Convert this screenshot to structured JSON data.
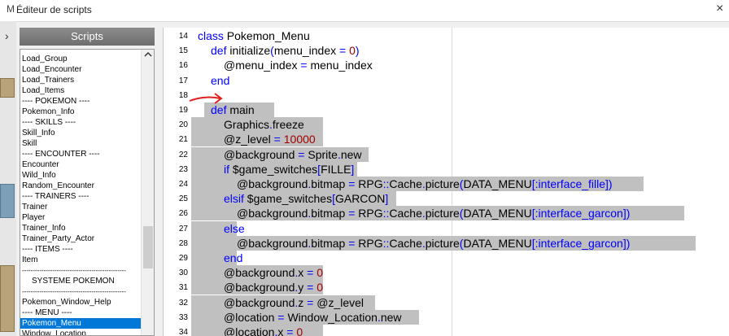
{
  "window": {
    "title": "Éditeur de scripts",
    "close": "×",
    "bg_letter": "M",
    "bg_arrow": "›"
  },
  "sidebar": {
    "header": "Scripts",
    "selected_index": 25,
    "items": [
      "Load_Group",
      "Load_Encounter",
      "Load_Trainers",
      "Load_Items",
      "---- POKEMON ----",
      "Pokemon_Info",
      "---- SKILLS ----",
      "Skill_Info",
      "Skill",
      "---- ENCOUNTER ----",
      "Encounter",
      "Wild_Info",
      "Random_Encounter",
      "---- TRAINERS ----",
      "Trainer",
      "Player",
      "Trainer_Info",
      "Trainer_Party_Actor",
      "---- ITEMS ----",
      "Item",
      "------------------------------------------------",
      "SYSTEME POKEMON",
      "------------------------------------------------",
      "Pokemon_Window_Help",
      "---- MENU ----",
      "Pokemon_Menu",
      "Window_Location"
    ]
  },
  "editor": {
    "lines": [
      {
        "n": "14",
        "sel": 0,
        "indent": 0,
        "t": [
          [
            "kw",
            "class"
          ],
          [
            "",
            "Pokemon_Menu"
          ]
        ]
      },
      {
        "n": "15",
        "sel": 0,
        "indent": 1,
        "t": [
          [
            "kw",
            "def"
          ],
          [
            "",
            "initialize"
          ],
          [
            "op",
            "("
          ],
          [
            "",
            "menu_index"
          ],
          [
            "op",
            " = "
          ],
          [
            "num",
            "0"
          ],
          [
            "op",
            ")"
          ]
        ]
      },
      {
        "n": "16",
        "sel": 0,
        "indent": 2,
        "t": [
          [
            "",
            "@menu_index"
          ],
          [
            "op",
            " = "
          ],
          [
            "",
            "menu_index"
          ]
        ]
      },
      {
        "n": "17",
        "sel": 0,
        "indent": 1,
        "t": [
          [
            "kw",
            "end"
          ]
        ]
      },
      {
        "n": "18",
        "sel": 0,
        "indent": 0,
        "t": []
      },
      {
        "n": "19",
        "sel": 86,
        "indent": 1,
        "t": [
          [
            "kw",
            "def"
          ],
          [
            "",
            "main"
          ]
        ]
      },
      {
        "n": "20",
        "sel": 162,
        "indent": 2,
        "t": [
          [
            "",
            "Graphics"
          ],
          [
            "op",
            "."
          ],
          [
            "",
            "freeze"
          ]
        ]
      },
      {
        "n": "21",
        "sel": 162,
        "indent": 2,
        "t": [
          [
            "",
            "@z_level"
          ],
          [
            "op",
            " = "
          ],
          [
            "num",
            "10000"
          ]
        ]
      },
      {
        "n": "22",
        "sel": 218,
        "indent": 2,
        "t": [
          [
            "",
            "@background"
          ],
          [
            "op",
            " = "
          ],
          [
            "",
            "Sprite"
          ],
          [
            "op",
            "."
          ],
          [
            "",
            "new"
          ]
        ]
      },
      {
        "n": "23",
        "sel": 204,
        "indent": 2,
        "t": [
          [
            "kw",
            "if"
          ],
          [
            "",
            ""
          ],
          [
            "",
            "$game_switches"
          ],
          [
            "op",
            "["
          ],
          [
            "",
            "FILLE"
          ],
          [
            "op",
            "]"
          ]
        ]
      },
      {
        "n": "24",
        "sel": 556,
        "indent": 3,
        "t": [
          [
            "",
            "@background"
          ],
          [
            "op",
            "."
          ],
          [
            "",
            "bitmap"
          ],
          [
            "op",
            " = "
          ],
          [
            "",
            "RPG"
          ],
          [
            "op",
            "::"
          ],
          [
            "",
            "Cache"
          ],
          [
            "op",
            "."
          ],
          [
            "",
            "picture"
          ],
          [
            "op",
            "("
          ],
          [
            "",
            "DATA_MENU"
          ],
          [
            "op",
            "["
          ],
          [
            "sym",
            ":interface_fille"
          ],
          [
            "op",
            "])"
          ]
        ]
      },
      {
        "n": "25",
        "sel": 252,
        "indent": 2,
        "t": [
          [
            "kw",
            "elsif"
          ],
          [
            "",
            ""
          ],
          [
            "",
            "$game_switches"
          ],
          [
            "op",
            "["
          ],
          [
            "",
            "GARCON"
          ],
          [
            "op",
            "]"
          ]
        ]
      },
      {
        "n": "26",
        "sel": 606,
        "indent": 3,
        "t": [
          [
            "",
            "@background"
          ],
          [
            "op",
            "."
          ],
          [
            "",
            "bitmap"
          ],
          [
            "op",
            " = "
          ],
          [
            "",
            "RPG"
          ],
          [
            "op",
            "::"
          ],
          [
            "",
            "Cache"
          ],
          [
            "op",
            "."
          ],
          [
            "",
            "picture"
          ],
          [
            "op",
            "("
          ],
          [
            "",
            "DATA_MENU"
          ],
          [
            "op",
            "["
          ],
          [
            "sym",
            ":interface_garcon"
          ],
          [
            "op",
            "])"
          ]
        ]
      },
      {
        "n": "27",
        "sel": 56,
        "indent": 2,
        "t": [
          [
            "kw",
            "else"
          ]
        ]
      },
      {
        "n": "28",
        "sel": 620,
        "indent": 3,
        "t": [
          [
            "",
            "@background"
          ],
          [
            "op",
            "."
          ],
          [
            "",
            "bitmap"
          ],
          [
            "op",
            " = "
          ],
          [
            "",
            "RPG"
          ],
          [
            "op",
            "::"
          ],
          [
            "",
            "Cache"
          ],
          [
            "op",
            "."
          ],
          [
            "",
            "picture"
          ],
          [
            "op",
            "("
          ],
          [
            "",
            "DATA_MENU"
          ],
          [
            "op",
            "["
          ],
          [
            "sym",
            ":interface_garcon"
          ],
          [
            "op",
            "])"
          ]
        ]
      },
      {
        "n": "29",
        "sel": 56,
        "indent": 2,
        "t": [
          [
            "kw",
            "end"
          ]
        ]
      },
      {
        "n": "30",
        "sel": 162,
        "indent": 2,
        "t": [
          [
            "",
            "@background"
          ],
          [
            "op",
            "."
          ],
          [
            "",
            "x"
          ],
          [
            "op",
            " = "
          ],
          [
            "num",
            "0"
          ]
        ]
      },
      {
        "n": "31",
        "sel": 162,
        "indent": 2,
        "t": [
          [
            "",
            "@background"
          ],
          [
            "op",
            "."
          ],
          [
            "",
            "y"
          ],
          [
            "op",
            " = "
          ],
          [
            "num",
            "0"
          ]
        ]
      },
      {
        "n": "32",
        "sel": 226,
        "indent": 2,
        "t": [
          [
            "",
            "@background"
          ],
          [
            "op",
            "."
          ],
          [
            "",
            "z"
          ],
          [
            "op",
            " = "
          ],
          [
            "",
            "@z_level"
          ]
        ]
      },
      {
        "n": "33",
        "sel": 280,
        "indent": 2,
        "t": [
          [
            "",
            "@location"
          ],
          [
            "op",
            " = "
          ],
          [
            "",
            "Window_Location"
          ],
          [
            "op",
            "."
          ],
          [
            "",
            "new"
          ]
        ]
      },
      {
        "n": "34",
        "sel": 162,
        "indent": 2,
        "t": [
          [
            "",
            "@location"
          ],
          [
            "op",
            "."
          ],
          [
            "",
            "x"
          ],
          [
            "op",
            " = "
          ],
          [
            "num",
            "0"
          ]
        ]
      }
    ]
  },
  "colors": {
    "keyword": "#0000ff",
    "number": "#a00000",
    "selection": "#c0c0c0",
    "list_selection": "#0078d7",
    "annotation": "#e02020"
  },
  "icons": {
    "annotation": "red-arrow-icon",
    "scroll_up": "chevron-up-icon"
  }
}
